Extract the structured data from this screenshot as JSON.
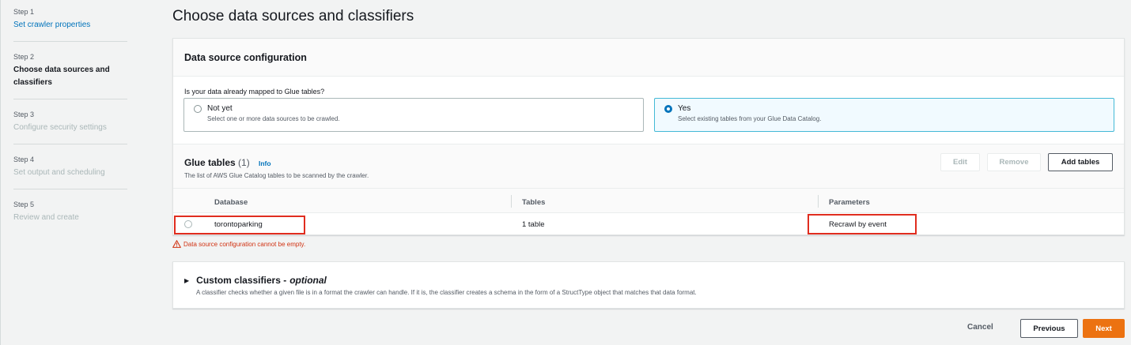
{
  "sidebar": {
    "steps": [
      {
        "num": "Step 1",
        "title": "Set crawler properties"
      },
      {
        "num": "Step 2",
        "title": "Choose data sources and classifiers"
      },
      {
        "num": "Step 3",
        "title": "Configure security settings"
      },
      {
        "num": "Step 4",
        "title": "Set output and scheduling"
      },
      {
        "num": "Step 5",
        "title": "Review and create"
      }
    ]
  },
  "main": {
    "title": "Choose data sources and classifiers",
    "ds_panel": {
      "header": "Data source configuration",
      "question": "Is your data already mapped to Glue tables?",
      "options": [
        {
          "label": "Not yet",
          "desc": "Select one or more data sources to be crawled."
        },
        {
          "label": "Yes",
          "desc": "Select existing tables from your Glue Data Catalog."
        }
      ]
    },
    "glue_tables": {
      "title": "Glue tables",
      "count": "(1)",
      "info": "Info",
      "desc": "The list of AWS Glue Catalog tables to be scanned by the crawler.",
      "edit_label": "Edit",
      "remove_label": "Remove",
      "add_label": "Add tables",
      "columns": [
        "Database",
        "Tables",
        "Parameters"
      ],
      "rows": [
        {
          "database": "torontoparking",
          "tables": "1 table",
          "parameters": "Recrawl by event"
        }
      ]
    },
    "error": "Data source configuration cannot be empty.",
    "custom_classifiers": {
      "title": "Custom classifiers - ",
      "optional": "optional",
      "desc": "A classifier checks whether a given file is in a format the crawler can handle. If it is, the classifier creates a schema in the form of a StructType object that matches that data format."
    }
  },
  "footer": {
    "cancel": "Cancel",
    "previous": "Previous",
    "next": "Next"
  },
  "colors": {
    "accent": "#0073bb",
    "primary_button": "#ec7211",
    "error": "#d13212",
    "highlight_box": "#e02d1f"
  }
}
